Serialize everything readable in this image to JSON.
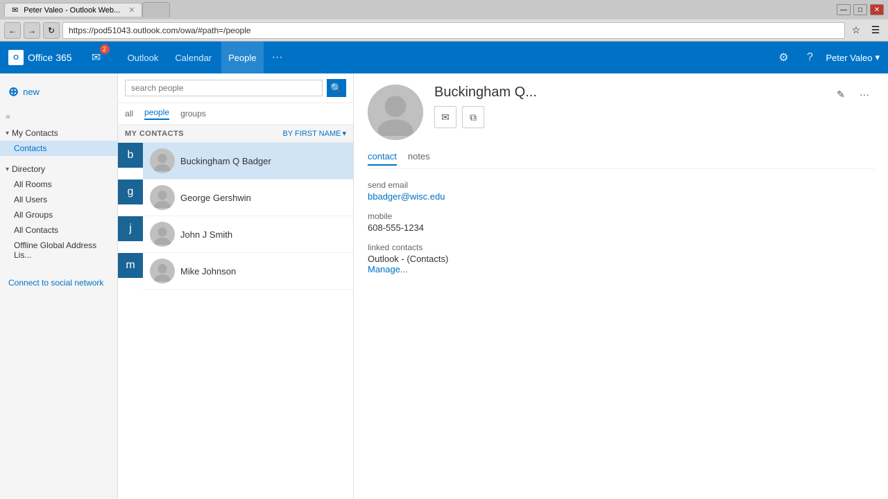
{
  "browser": {
    "tab_title": "Peter Valeo - Outlook Web...",
    "tab_active": true,
    "address": "https://pod51043.outlook.com/owa/#path=/people",
    "favicon": "✉"
  },
  "header": {
    "office365_label": "Office 365",
    "nav_items": [
      {
        "id": "outlook",
        "label": "Outlook"
      },
      {
        "id": "calendar",
        "label": "Calendar"
      },
      {
        "id": "people",
        "label": "People",
        "active": true
      },
      {
        "id": "more",
        "label": "···"
      }
    ],
    "user": "Peter Valeo",
    "mail_count": "2"
  },
  "sidebar": {
    "new_label": "new",
    "my_contacts_section": {
      "label": "My Contacts",
      "items": [
        {
          "id": "contacts",
          "label": "Contacts",
          "active": false
        }
      ]
    },
    "directory_section": {
      "label": "Directory",
      "items": [
        {
          "id": "all-rooms",
          "label": "All Rooms"
        },
        {
          "id": "all-users",
          "label": "All Users"
        },
        {
          "id": "all-groups",
          "label": "All Groups"
        },
        {
          "id": "all-contacts",
          "label": "All Contacts"
        },
        {
          "id": "offline-gal",
          "label": "Offline Global Address Lis..."
        }
      ]
    },
    "connect_label": "Connect to social network"
  },
  "people_list": {
    "search_placeholder": "search people",
    "tabs": [
      {
        "id": "all",
        "label": "all"
      },
      {
        "id": "people",
        "label": "people",
        "active": true
      },
      {
        "id": "groups",
        "label": "groups"
      }
    ],
    "contacts_section_label": "MY CONTACTS",
    "sort_label": "BY FIRST NAME",
    "letter_groups": [
      {
        "letter": "b",
        "contacts": [
          {
            "id": 1,
            "name": "Buckingham Q Badger",
            "selected": true
          }
        ]
      },
      {
        "letter": "g",
        "contacts": [
          {
            "id": 2,
            "name": "George Gershwin",
            "selected": false
          }
        ]
      },
      {
        "letter": "j",
        "contacts": [
          {
            "id": 3,
            "name": "John J Smith",
            "selected": false
          }
        ]
      },
      {
        "letter": "m",
        "contacts": [
          {
            "id": 4,
            "name": "Mike Johnson",
            "selected": false
          }
        ]
      }
    ]
  },
  "detail": {
    "name": "Buckingham Q...",
    "tabs": [
      {
        "id": "contact",
        "label": "contact",
        "active": true
      },
      {
        "id": "notes",
        "label": "notes"
      }
    ],
    "fields": {
      "send_email_label": "send email",
      "send_email_value": "bbadger@wisc.edu",
      "mobile_label": "mobile",
      "mobile_value": "608-555-1234",
      "linked_contacts_label": "linked contacts",
      "linked_contacts_value": "Outlook - (Contacts)",
      "manage_label": "Manage..."
    }
  }
}
